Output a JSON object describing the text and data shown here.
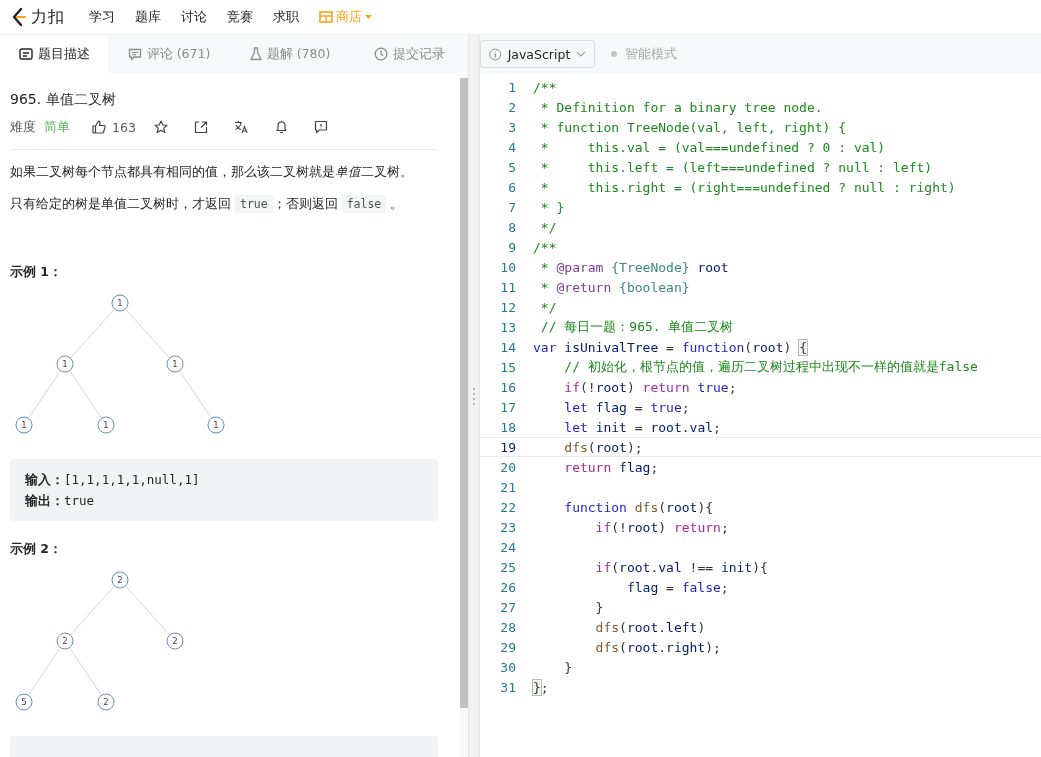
{
  "header": {
    "logo_text": "力扣",
    "nav": [
      {
        "label": "学习",
        "kind": "link"
      },
      {
        "label": "题库",
        "kind": "link"
      },
      {
        "label": "讨论",
        "kind": "link"
      },
      {
        "label": "竞赛",
        "kind": "link"
      },
      {
        "label": "求职",
        "kind": "link"
      },
      {
        "label": "商店",
        "kind": "store"
      }
    ]
  },
  "tabs": [
    {
      "label": "题目描述",
      "selected": true
    },
    {
      "label": "评论 (671)",
      "selected": false
    },
    {
      "label": "题解 (780)",
      "selected": false
    },
    {
      "label": "提交记录",
      "selected": false
    }
  ],
  "editor_toolbar": {
    "language": "JavaScript",
    "smart_mode": {
      "label": "智能模式",
      "on": false
    }
  },
  "problem": {
    "title": "965. 单值二叉树",
    "difficulty_label": "难度",
    "difficulty": "简单",
    "likes": "163",
    "paragraphs": [
      [
        {
          "kind": "text",
          "text": "如果二叉树每个节点都具有相同的值，那么该二叉树就是"
        },
        {
          "kind": "em",
          "text": "单值"
        },
        {
          "kind": "text",
          "text": "二叉树。"
        }
      ],
      [
        {
          "kind": "text",
          "text": "只有给定的树是单值二叉树时，才返回 "
        },
        {
          "kind": "code",
          "text": "true"
        },
        {
          "kind": "text",
          "text": "；否则返回 "
        },
        {
          "kind": "code",
          "text": "false"
        },
        {
          "kind": "text",
          "text": " 。"
        }
      ]
    ],
    "examples": [
      {
        "title": "示例 1：",
        "tree": {
          "value": "1",
          "children": [
            {
              "value": "1",
              "kind": "left",
              "children": [
                {
                  "value": "1",
                  "kind": "left"
                },
                {
                  "value": "1",
                  "kind": "right"
                }
              ]
            },
            {
              "value": "1",
              "kind": "right",
              "children": [
                {
                  "value": "1",
                  "kind": "right"
                }
              ]
            }
          ]
        },
        "io": [
          "**输入：**[1,1,1,1,1,null,1]",
          "**输出：**true"
        ]
      },
      {
        "title": "示例 2：",
        "tree": {
          "value": "2",
          "children": [
            {
              "value": "2",
              "kind": "left",
              "children": [
                {
                  "value": "5",
                  "kind": "left"
                },
                {
                  "value": "2",
                  "kind": "right"
                }
              ]
            },
            {
              "value": "2",
              "kind": "right"
            }
          ]
        }
      }
    ]
  },
  "code": [
    {
      "n": "1",
      "tokens": [
        {
          "kind": "comment",
          "text": "/**"
        }
      ]
    },
    {
      "n": "2",
      "tokens": [
        {
          "kind": "comment",
          "text": " * Definition for a binary tree node."
        }
      ]
    },
    {
      "n": "3",
      "tokens": [
        {
          "kind": "comment",
          "text": " * function TreeNode(val, left, right) {"
        }
      ]
    },
    {
      "n": "4",
      "tokens": [
        {
          "kind": "comment",
          "text": " *     this.val = (val===undefined ? 0 : val)"
        }
      ]
    },
    {
      "n": "5",
      "tokens": [
        {
          "kind": "comment",
          "text": " *     this.left = (left===undefined ? null : left)"
        }
      ]
    },
    {
      "n": "6",
      "tokens": [
        {
          "kind": "comment",
          "text": " *     this.right = (right===undefined ? null : right)"
        }
      ]
    },
    {
      "n": "7",
      "tokens": [
        {
          "kind": "comment",
          "text": " * }"
        }
      ]
    },
    {
      "n": "8",
      "tokens": [
        {
          "kind": "comment",
          "text": " */"
        }
      ]
    },
    {
      "n": "9",
      "tokens": [
        {
          "kind": "comment",
          "text": "/**"
        }
      ]
    },
    {
      "n": "10",
      "tokens": [
        {
          "kind": "comment",
          "text": " * "
        },
        {
          "kind": "doctag",
          "text": "@param "
        },
        {
          "kind": "doctype",
          "text": "{TreeNode} "
        },
        {
          "kind": "identifier",
          "text": "root"
        }
      ]
    },
    {
      "n": "11",
      "tokens": [
        {
          "kind": "comment",
          "text": " * "
        },
        {
          "kind": "doctag",
          "text": "@return "
        },
        {
          "kind": "doctype",
          "text": "{boolean}"
        }
      ]
    },
    {
      "n": "12",
      "tokens": [
        {
          "kind": "comment",
          "text": " */"
        }
      ]
    },
    {
      "n": "13",
      "tokens": [
        {
          "kind": "comment",
          "text": " // 每日一题：965. 单值二叉树"
        }
      ]
    },
    {
      "n": "14",
      "tokens": [
        {
          "kind": "keyword",
          "text": "var "
        },
        {
          "kind": "identifier",
          "text": "isUnivalTree"
        },
        {
          "kind": "punct",
          "text": " = "
        },
        {
          "kind": "keyword",
          "text": "function"
        },
        {
          "kind": "punct",
          "text": "("
        },
        {
          "kind": "identifier",
          "text": "root"
        },
        {
          "kind": "punct",
          "text": ") "
        },
        {
          "kind": "bracket",
          "text": "{"
        }
      ]
    },
    {
      "n": "15",
      "tokens": [
        {
          "kind": "comment",
          "text": "    // 初始化，根节点的值，遍历二叉树过程中出现不一样的值就是false"
        }
      ]
    },
    {
      "n": "16",
      "tokens": [
        {
          "kind": "control",
          "text": "    if"
        },
        {
          "kind": "punct",
          "text": "(!"
        },
        {
          "kind": "identifier",
          "text": "root"
        },
        {
          "kind": "punct",
          "text": ") "
        },
        {
          "kind": "control",
          "text": "return "
        },
        {
          "kind": "keyword",
          "text": "true"
        },
        {
          "kind": "punct",
          "text": ";"
        }
      ]
    },
    {
      "n": "17",
      "tokens": [
        {
          "kind": "keyword",
          "text": "    let "
        },
        {
          "kind": "identifier",
          "text": "flag"
        },
        {
          "kind": "punct",
          "text": " = "
        },
        {
          "kind": "keyword",
          "text": "true"
        },
        {
          "kind": "punct",
          "text": ";"
        }
      ]
    },
    {
      "n": "18",
      "tokens": [
        {
          "kind": "keyword",
          "text": "    let "
        },
        {
          "kind": "identifier",
          "text": "init"
        },
        {
          "kind": "punct",
          "text": " = "
        },
        {
          "kind": "identifier",
          "text": "root"
        },
        {
          "kind": "punct",
          "text": "."
        },
        {
          "kind": "identifier",
          "text": "val"
        },
        {
          "kind": "punct",
          "text": ";"
        }
      ]
    },
    {
      "n": "19",
      "current": true,
      "tokens": [
        {
          "kind": "function",
          "text": "    dfs"
        },
        {
          "kind": "punct",
          "text": "("
        },
        {
          "kind": "identifier",
          "text": "root"
        },
        {
          "kind": "punct",
          "text": ");"
        }
      ]
    },
    {
      "n": "20",
      "tokens": [
        {
          "kind": "control",
          "text": "    return "
        },
        {
          "kind": "identifier",
          "text": "flag"
        },
        {
          "kind": "punct",
          "text": ";"
        }
      ]
    },
    {
      "n": "21"
    },
    {
      "n": "22",
      "tokens": [
        {
          "kind": "keyword",
          "text": "    function "
        },
        {
          "kind": "function",
          "text": "dfs"
        },
        {
          "kind": "punct",
          "text": "("
        },
        {
          "kind": "identifier",
          "text": "root"
        },
        {
          "kind": "punct",
          "text": "){"
        }
      ]
    },
    {
      "n": "23",
      "tokens": [
        {
          "kind": "control",
          "text": "        if"
        },
        {
          "kind": "punct",
          "text": "(!"
        },
        {
          "kind": "identifier",
          "text": "root"
        },
        {
          "kind": "punct",
          "text": ") "
        },
        {
          "kind": "control",
          "text": "return"
        },
        {
          "kind": "punct",
          "text": ";"
        }
      ]
    },
    {
      "n": "24"
    },
    {
      "n": "25",
      "tokens": [
        {
          "kind": "control",
          "text": "        if"
        },
        {
          "kind": "punct",
          "text": "("
        },
        {
          "kind": "identifier",
          "text": "root"
        },
        {
          "kind": "punct",
          "text": "."
        },
        {
          "kind": "identifier",
          "text": "val"
        },
        {
          "kind": "punct",
          "text": " !== "
        },
        {
          "kind": "identifier",
          "text": "init"
        },
        {
          "kind": "punct",
          "text": "){"
        }
      ]
    },
    {
      "n": "26",
      "tokens": [
        {
          "kind": "identifier",
          "text": "            flag"
        },
        {
          "kind": "punct",
          "text": " = "
        },
        {
          "kind": "keyword",
          "text": "false"
        },
        {
          "kind": "punct",
          "text": ";"
        }
      ]
    },
    {
      "n": "27",
      "tokens": [
        {
          "kind": "punct",
          "text": "        }"
        }
      ]
    },
    {
      "n": "28",
      "tokens": [
        {
          "kind": "function",
          "text": "        dfs"
        },
        {
          "kind": "punct",
          "text": "("
        },
        {
          "kind": "identifier",
          "text": "root"
        },
        {
          "kind": "punct",
          "text": "."
        },
        {
          "kind": "identifier",
          "text": "left"
        },
        {
          "kind": "punct",
          "text": ")"
        }
      ]
    },
    {
      "n": "29",
      "tokens": [
        {
          "kind": "function",
          "text": "        dfs"
        },
        {
          "kind": "punct",
          "text": "("
        },
        {
          "kind": "identifier",
          "text": "root"
        },
        {
          "kind": "punct",
          "text": "."
        },
        {
          "kind": "identifier",
          "text": "right"
        },
        {
          "kind": "punct",
          "text": ");"
        }
      ]
    },
    {
      "n": "30",
      "tokens": [
        {
          "kind": "punct",
          "text": "    }"
        }
      ]
    },
    {
      "n": "31",
      "tokens": [
        {
          "kind": "bracket",
          "text": "}"
        },
        {
          "kind": "punct",
          "text": ";"
        }
      ]
    }
  ]
}
